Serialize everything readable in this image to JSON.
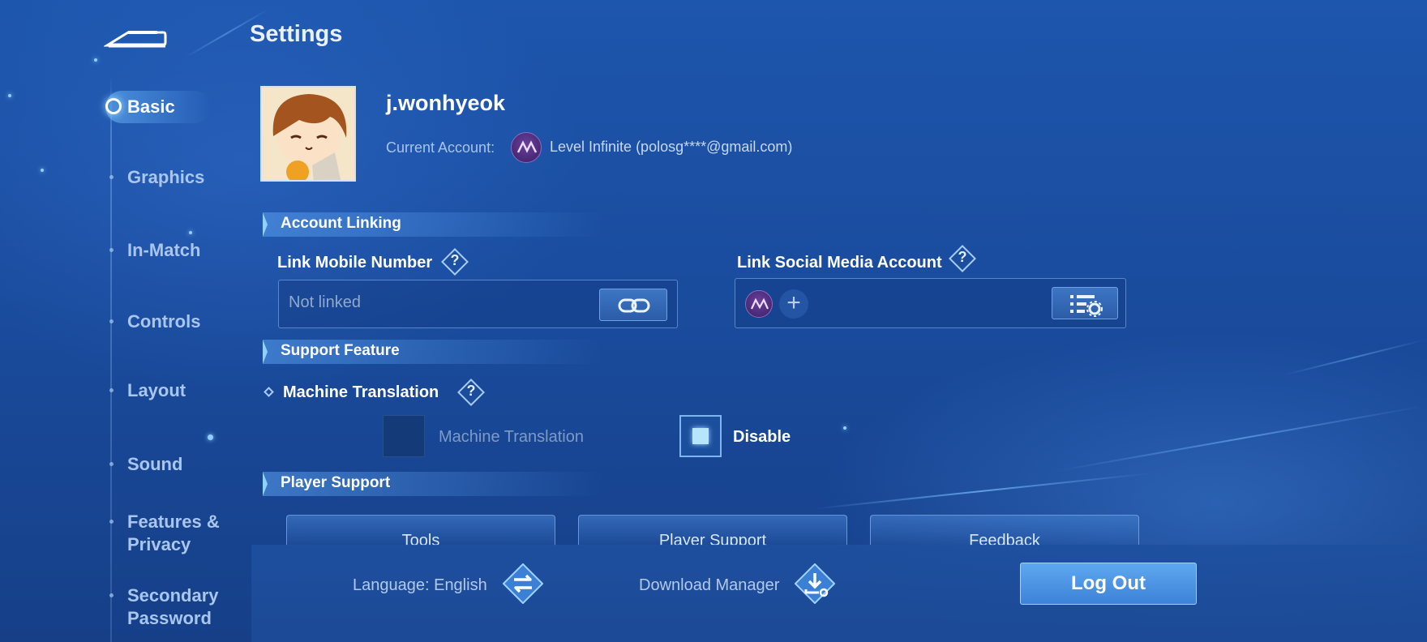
{
  "header": {
    "title": "Settings"
  },
  "sidebar": {
    "items": [
      {
        "label": "Basic",
        "active": true
      },
      {
        "label": "Graphics"
      },
      {
        "label": "In-Match"
      },
      {
        "label": "Controls"
      },
      {
        "label": "Layout"
      },
      {
        "label": "Sound"
      },
      {
        "label": "Features &\nPrivacy"
      },
      {
        "label": "Secondary\nPassword"
      }
    ]
  },
  "profile": {
    "username": "j.wonhyeok",
    "current_account_label": "Current Account:",
    "current_account_value": "Level Infinite (polosg****@gmail.com)"
  },
  "account_linking": {
    "header": "Account Linking",
    "mobile_label": "Link Mobile Number",
    "mobile_value": "Not linked",
    "social_label": "Link Social Media Account"
  },
  "support_feature": {
    "header": "Support Feature",
    "mt_label": "Machine Translation",
    "option_enable": "Machine Translation",
    "option_disable": "Disable"
  },
  "player_support": {
    "header": "Player Support",
    "buttons": [
      "Tools",
      "Player Support",
      "Feedback"
    ]
  },
  "bottom": {
    "language": "Language: English",
    "download": "Download Manager",
    "logout": "Log Out"
  },
  "colors": {
    "accent": "#4f99e8",
    "background": "#1a4c9e"
  }
}
